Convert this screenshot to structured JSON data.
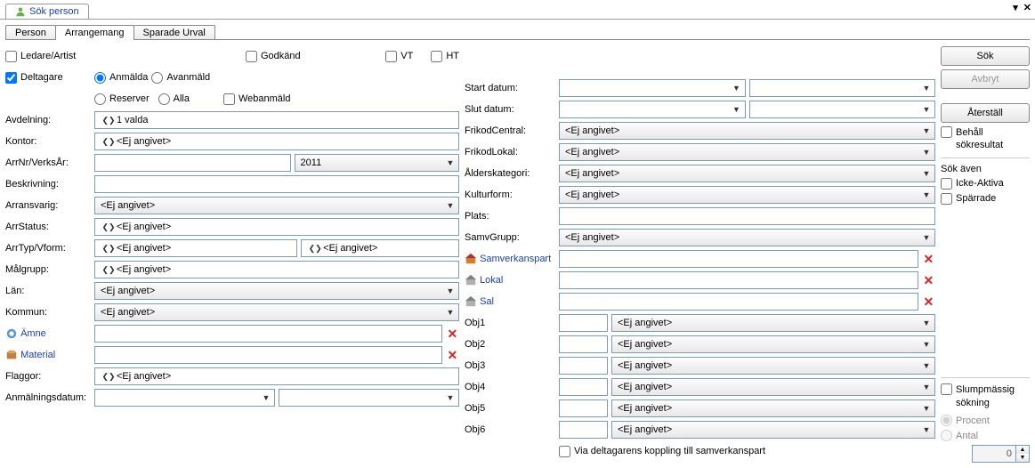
{
  "window": {
    "title": "Sök person",
    "minimize": "▾",
    "close": "✕"
  },
  "tabs": {
    "items": [
      "Person",
      "Arrangemang",
      "Sparade Urval"
    ],
    "active": 1
  },
  "left": {
    "ledare_artist": "Ledare/Artist",
    "deltagare": "Deltagare",
    "godkand": "Godkänd",
    "vt": "VT",
    "ht": "HT",
    "radios1": {
      "anmalda": "Anmälda",
      "avanmald": "Avanmäld"
    },
    "radios2": {
      "reserver": "Reserver",
      "alla": "Alla"
    },
    "webanmald": "Webanmäld",
    "avdelning": {
      "label": "Avdelning:",
      "value": "1 valda"
    },
    "kontor": {
      "label": "Kontor:",
      "value": "<Ej angivet>"
    },
    "arrnr": {
      "label": "ArrNr/VerksÅr:",
      "year": "2011"
    },
    "beskrivning": {
      "label": "Beskrivning:"
    },
    "arransvarig": {
      "label": "Arransvarig:",
      "value": "<Ej angivet>"
    },
    "arrstatus": {
      "label": "ArrStatus:",
      "value": "<Ej angivet>"
    },
    "arrtyp": {
      "label": "ArrTyp/Vform:",
      "value1": "<Ej angivet>",
      "value2": "<Ej angivet>"
    },
    "malgrupp": {
      "label": "Målgrupp:",
      "value": "<Ej angivet>"
    },
    "lan": {
      "label": "Län:",
      "value": "<Ej angivet>"
    },
    "kommun": {
      "label": "Kommun:",
      "value": "<Ej angivet>"
    },
    "amne": {
      "label": "Ämne"
    },
    "material": {
      "label": "Material"
    },
    "flaggor": {
      "label": "Flaggor:",
      "value": "<Ej angivet>"
    },
    "anmdatum": {
      "label": "Anmälningsdatum:"
    }
  },
  "mid": {
    "startdatum": {
      "label": "Start datum:"
    },
    "slutdatum": {
      "label": "Slut datum:"
    },
    "frikodcentral": {
      "label": "FrikodCentral:",
      "value": "<Ej angivet>"
    },
    "frikodlokal": {
      "label": "FrikodLokal:",
      "value": "<Ej angivet>"
    },
    "alderskategori": {
      "label": "Ålderskategori:",
      "value": "<Ej angivet>"
    },
    "kulturform": {
      "label": "Kulturform:",
      "value": "<Ej angivet>"
    },
    "plats": {
      "label": "Plats:"
    },
    "samvgrupp": {
      "label": "SamvGrupp:",
      "value": "<Ej angivet>"
    },
    "samverkanspart": {
      "label": "Samverkanspart"
    },
    "lokal": {
      "label": "Lokal"
    },
    "sal": {
      "label": "Sal"
    },
    "obj": [
      {
        "label": "Obj1",
        "value": "<Ej angivet>"
      },
      {
        "label": "Obj2",
        "value": "<Ej angivet>"
      },
      {
        "label": "Obj3",
        "value": "<Ej angivet>"
      },
      {
        "label": "Obj4",
        "value": "<Ej angivet>"
      },
      {
        "label": "Obj5",
        "value": "<Ej angivet>"
      },
      {
        "label": "Obj6",
        "value": "<Ej angivet>"
      }
    ],
    "via_deltagarens": "Via deltagarens koppling till samverkanspart"
  },
  "right": {
    "sok": "Sök",
    "avbryt": "Avbryt",
    "aterstall": "Återställ",
    "behall": "Behåll sökresultat",
    "sok_aven": "Sök även",
    "icke_aktiva": "Icke-Aktiva",
    "sparrade": "Spärrade",
    "slump": "Slumpmässig sökning",
    "procent": "Procent",
    "antal": "Antal",
    "spin_value": "0"
  }
}
